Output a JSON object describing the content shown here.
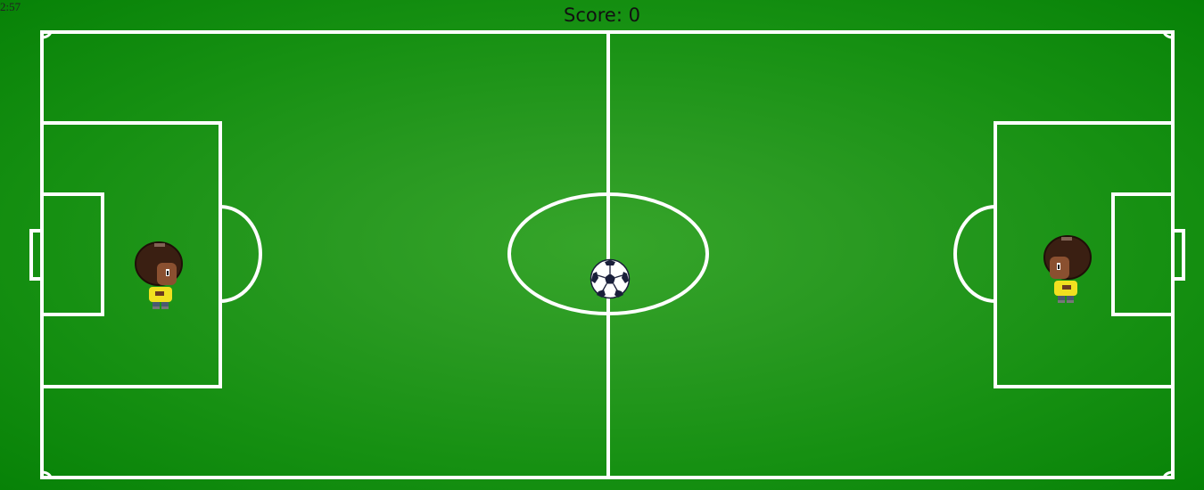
{
  "hud": {
    "timer": "2:57",
    "score_label": "Score: 0"
  },
  "colors": {
    "grass_center": "#36a52a",
    "grass_edge": "#078207",
    "lines": "#ffffff",
    "player_hair": "#3a1f12",
    "player_skin": "#8a5030",
    "player_shirt": "#f0e020"
  },
  "entities": {
    "ball": "soccer-ball",
    "players": [
      "left-team-player",
      "right-team-player"
    ]
  }
}
